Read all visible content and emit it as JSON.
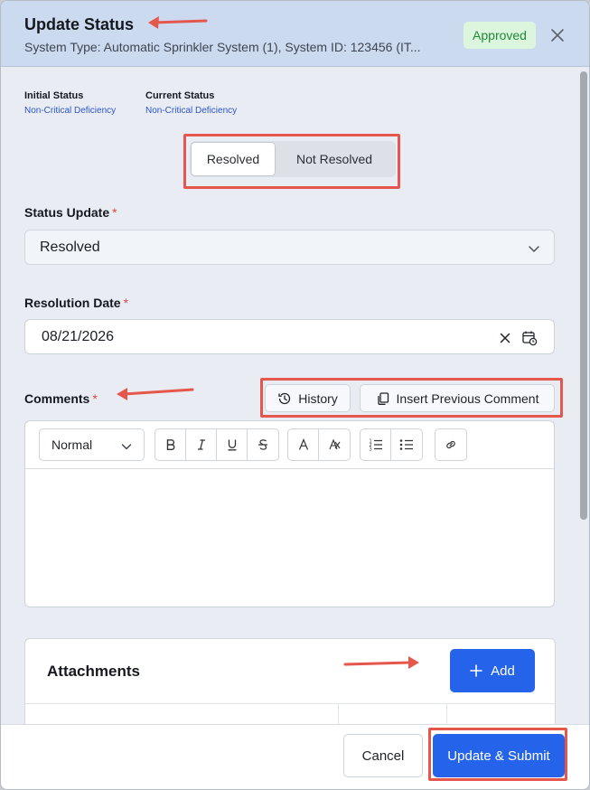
{
  "header": {
    "title": "Update Status",
    "subtitle": "System Type: Automatic Sprinkler System (1), System ID: 123456 (IT...",
    "badge": "Approved",
    "badge_color": "#1f8a37"
  },
  "status_info": {
    "initial_label": "Initial Status",
    "initial_value": "Non-Critical Deficiency",
    "current_label": "Current Status",
    "current_value": "Non-Critical Deficiency"
  },
  "toggle": {
    "options": [
      "Resolved",
      "Not Resolved"
    ],
    "selected": "Resolved"
  },
  "status_update": {
    "label": "Status Update",
    "required_mark": "*",
    "value": "Resolved"
  },
  "resolution_date": {
    "label": "Resolution Date",
    "required_mark": "*",
    "value": "08/21/2026"
  },
  "comments": {
    "label": "Comments",
    "required_mark": "*",
    "history_label": "History",
    "insert_label": "Insert Previous Comment",
    "format_select": "Normal",
    "body_text": ""
  },
  "attachments": {
    "title": "Attachments",
    "add_label": "Add"
  },
  "footer": {
    "cancel_label": "Cancel",
    "submit_label": "Update & Submit"
  },
  "colors": {
    "primary": "#2563eb",
    "header_bg": "#ccdaf0",
    "annotation": "#e5574c",
    "required": "#e04444",
    "status_link": "#2c55c9"
  }
}
